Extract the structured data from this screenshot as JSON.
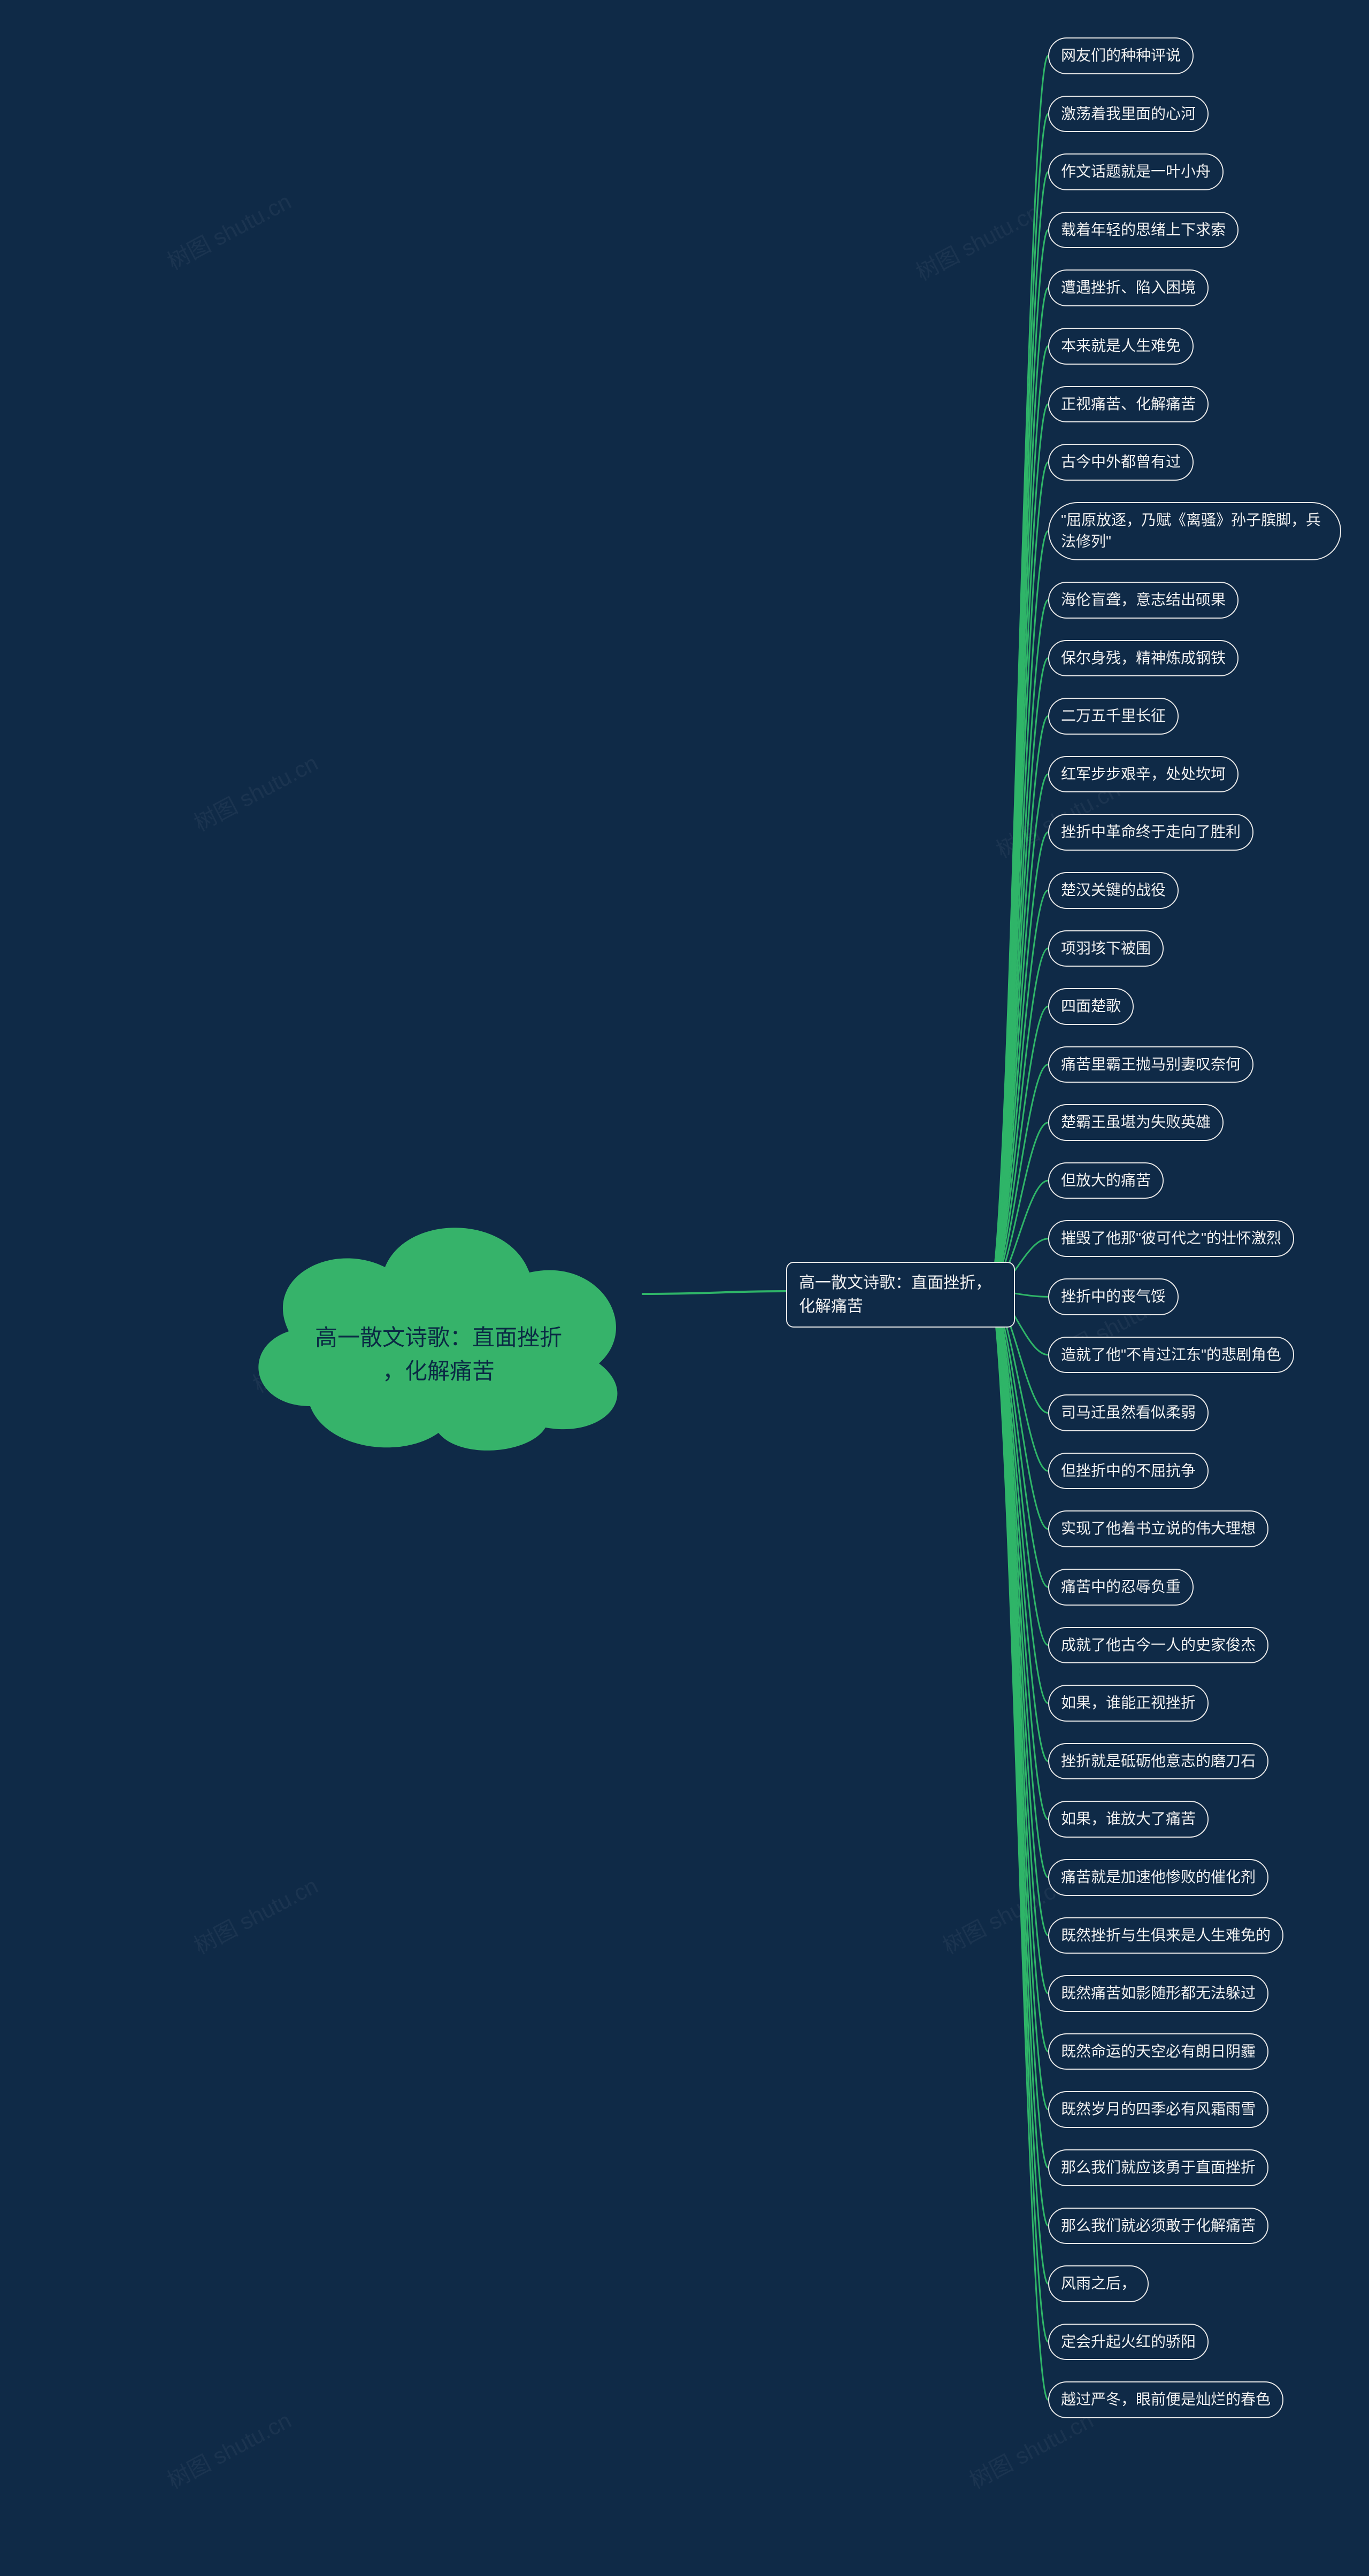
{
  "root": {
    "title_line1": "高一散文诗歌：直面挫折",
    "title_line2": "，化解痛苦"
  },
  "mid": {
    "label": "高一散文诗歌：直面挫折，化解痛苦"
  },
  "leaves": [
    "网友们的种种评说",
    "激荡着我里面的心河",
    "作文话题就是一叶小舟",
    "载着年轻的思绪上下求索",
    "遭遇挫折、陷入困境",
    "本来就是人生难免",
    "正视痛苦、化解痛苦",
    "古今中外都曾有过",
    "\"屈原放逐，乃赋《离骚》孙子膑脚，兵法修列\"",
    "海伦盲聋，意志结出硕果",
    "保尔身残，精神炼成钢铁",
    "二万五千里长征",
    "红军步步艰辛，处处坎坷",
    "挫折中革命终于走向了胜利",
    "楚汉关键的战役",
    "项羽垓下被围",
    "四面楚歌",
    "痛苦里霸王抛马别妻叹奈何",
    "楚霸王虽堪为失败英雄",
    "但放大的痛苦",
    "摧毁了他那\"彼可代之\"的壮怀激烈",
    "挫折中的丧气馁",
    "造就了他\"不肯过江东\"的悲剧角色",
    "司马迁虽然看似柔弱",
    "但挫折中的不屈抗争",
    "实现了他着书立说的伟大理想",
    "痛苦中的忍辱负重",
    "成就了他古今一人的史家俊杰",
    "如果，谁能正视挫折",
    "挫折就是砥砺他意志的磨刀石",
    "如果，谁放大了痛苦",
    "痛苦就是加速他惨败的催化剂",
    "既然挫折与生俱来是人生难免的",
    "既然痛苦如影随形都无法躲过",
    "既然命运的天空必有朗日阴霾",
    "既然岁月的四季必有风霜雨雪",
    "那么我们就应该勇于直面挫折",
    "那么我们就必须敢于化解痛苦",
    "风雨之后，",
    "定会升起火红的骄阳",
    "越过严冬，眼前便是灿烂的春色"
  ],
  "watermark": "树图 shutu.cn"
}
